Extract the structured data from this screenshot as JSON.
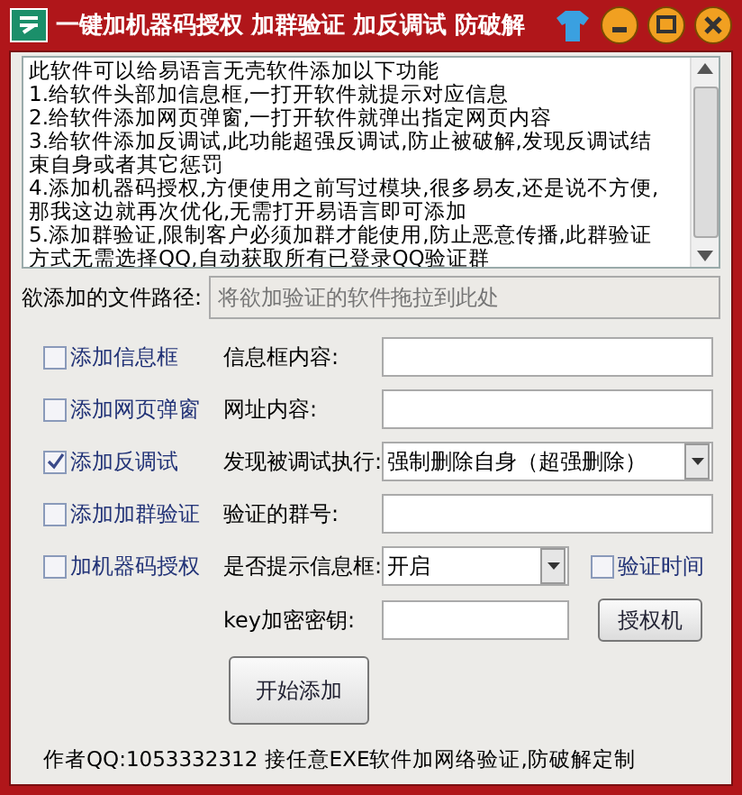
{
  "window": {
    "title": "一键加机器码授权 加群验证 加反调试 防破解"
  },
  "description": {
    "lines": [
      "此软件可以给易语言无壳软件添加以下功能",
      "1.给软件头部加信息框,一打开软件就提示对应信息",
      "2.给软件添加网页弹窗,一打开软件就弹出指定网页内容",
      "3.给软件添加反调试,此功能超强反调试,防止被破解,发现反调试结束自身或者其它惩罚",
      "4.添加机器码授权,方便使用之前写过模块,很多易友,还是说不方便,那我这边就再次优化,无需打开易语言即可添加",
      "5.添加群验证,限制客户必须加群才能使用,防止恶意传播,此群验证方式无需选择QQ,自动获取所有已登录QQ验证群"
    ]
  },
  "file_path": {
    "label": "欲添加的文件路径:",
    "placeholder": "将欲加验证的软件拖拉到此处"
  },
  "rows": [
    {
      "option": {
        "label": "添加信息框",
        "checked": false
      },
      "field_label": "信息框内容:",
      "field": {
        "kind": "text"
      }
    },
    {
      "option": {
        "label": "添加网页弹窗",
        "checked": false
      },
      "field_label": "网址内容:",
      "field": {
        "kind": "text"
      }
    },
    {
      "option": {
        "label": "添加反调试",
        "checked": true
      },
      "field_label": "发现被调试执行:",
      "field": {
        "kind": "select",
        "value": "强制删除自身（超强删除）"
      }
    },
    {
      "option": {
        "label": "添加加群验证",
        "checked": false
      },
      "field_label": "验证的群号:",
      "field": {
        "kind": "text"
      }
    },
    {
      "option": {
        "label": "加机器码授权",
        "checked": false
      },
      "field_label": "是否提示信息框:",
      "field": {
        "kind": "select",
        "value": "开启"
      },
      "extra": {
        "kind": "checkbox",
        "label": "验证时间",
        "checked": false
      }
    },
    {
      "field_label": "key加密密钥:",
      "field": {
        "kind": "text"
      },
      "extra": {
        "kind": "button",
        "label": "授权机"
      }
    }
  ],
  "start_button": "开始添加",
  "footer": "作者QQ:1053332312 接任意EXE软件加网络验证,防破解定制"
}
